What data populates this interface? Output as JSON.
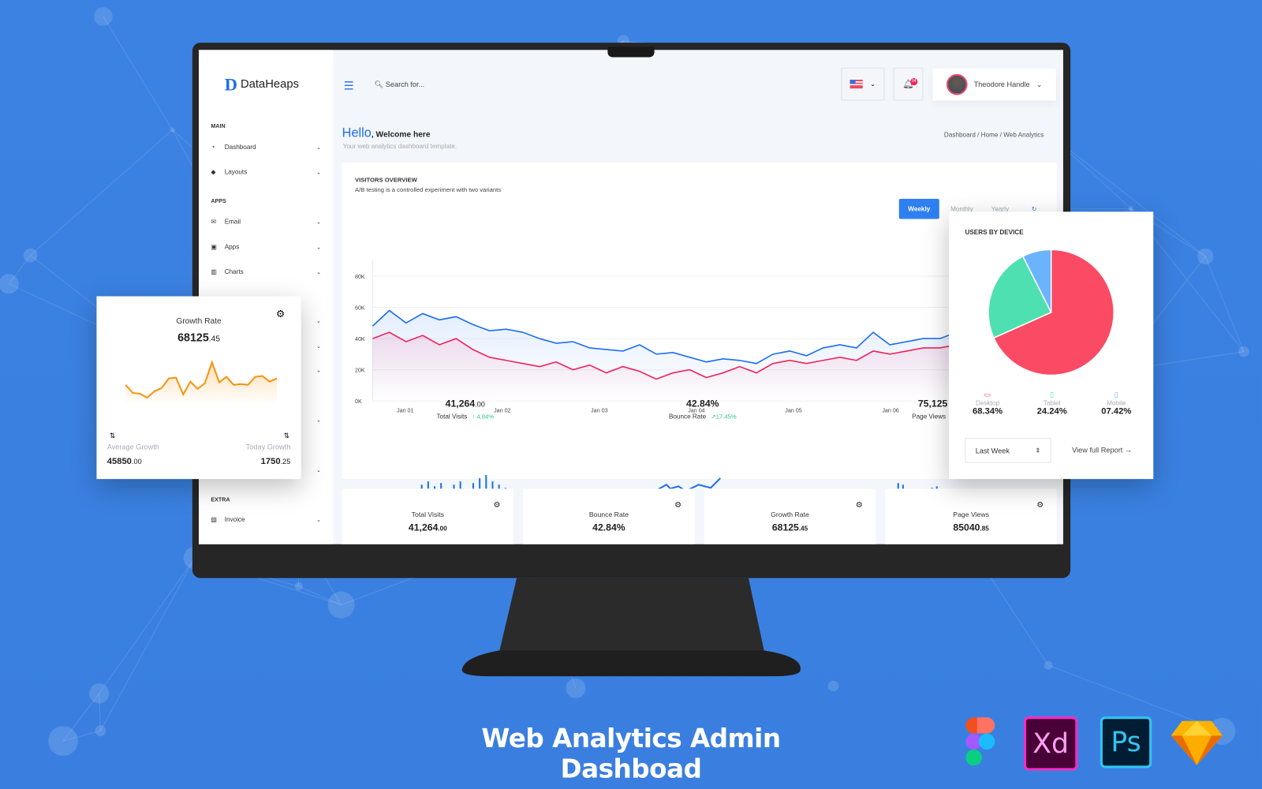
{
  "brand": {
    "name": "DataHeaps",
    "logo_letter": "D"
  },
  "search": {
    "placeholder": "Search for..."
  },
  "header": {
    "user_name": "Theodore Handle",
    "notifications": "04",
    "language": "us-flag-icon"
  },
  "sidebar": {
    "sections": [
      {
        "label": "MAIN",
        "items": [
          {
            "label": "Dashboard",
            "icon": "gauge-icon"
          },
          {
            "label": "Layouts",
            "icon": "layers-icon"
          }
        ]
      },
      {
        "label": "APPS",
        "items": [
          {
            "label": "Email",
            "icon": "envelope-icon"
          },
          {
            "label": "Apps",
            "icon": "tablet-icon"
          },
          {
            "label": "Charts",
            "icon": "bar-chart-icon"
          }
        ]
      },
      {
        "label": "EXTRA",
        "items": [
          {
            "label": "Invoice",
            "icon": "invoice-icon"
          }
        ]
      }
    ]
  },
  "page": {
    "hello": "Hello",
    "welcome": ", Welcome here",
    "subtitle": "Your web analytics dashboard template.",
    "breadcrumb": "Dashboard / Home / Web Analytics"
  },
  "visitors": {
    "title": "VISITORS OVERVIEW",
    "subtitle": "A/B testing is a controlled experiment with two variants",
    "tabs": [
      "Weekly",
      "Monthly",
      "Yearly"
    ],
    "active_tab": "Weekly",
    "stats": [
      {
        "value": "41,264",
        "decimals": ".00",
        "label": "Total Visits",
        "change": "↑ 4.84%"
      },
      {
        "value": "42.84%",
        "decimals": "",
        "label": "Bounce Rate",
        "change": "↗17.45%"
      },
      {
        "value": "75,125",
        "decimals": "",
        "label": "Page Views",
        "change": "↑"
      }
    ]
  },
  "chart_data": {
    "type": "line",
    "x_labels": [
      "Jan 01",
      "Jan 02",
      "Jan 03",
      "Jan 04",
      "Jan 05",
      "Jan 06"
    ],
    "y_ticks": [
      "0K",
      "20K",
      "40K",
      "60K",
      "80K"
    ],
    "ylim": [
      0,
      80000
    ],
    "grid": true,
    "colors": [
      "#1e6ff0",
      "#f0245f"
    ],
    "series": [
      {
        "values": [
          48000,
          58000,
          50000,
          56000,
          52000,
          54000,
          49000,
          45000,
          46000,
          44000,
          40000,
          37000,
          38000,
          34000,
          33000,
          32000,
          36000,
          30000,
          31000,
          28000,
          25000,
          27000,
          26000,
          24000,
          30000,
          32000,
          29000,
          34000,
          36000,
          34000,
          44000,
          36000,
          38000,
          40000,
          40000,
          44000,
          46000,
          48000,
          50000,
          52000,
          55000,
          50000
        ]
      },
      {
        "values": [
          40000,
          44000,
          38000,
          42000,
          36000,
          40000,
          33000,
          28000,
          26000,
          24000,
          22000,
          25000,
          20000,
          23000,
          18000,
          22000,
          19000,
          14000,
          18000,
          20000,
          15000,
          18000,
          22000,
          18000,
          24000,
          26000,
          24000,
          26000,
          28000,
          26000,
          32000,
          30000,
          32000,
          34000,
          34000,
          36000,
          38000,
          40000,
          38000,
          42000,
          44000,
          40000
        ]
      }
    ]
  },
  "mini_cards": [
    {
      "label": "Total Visits",
      "value": "41,264",
      "decimals": ".00"
    },
    {
      "label": "Bounce Rate",
      "value": "42.84%",
      "decimals": ""
    },
    {
      "label": "Growth Rate",
      "value": "68125",
      "decimals": ".45"
    },
    {
      "label": "Page Views",
      "value": "85040",
      "decimals": ".85"
    }
  ],
  "growth": {
    "title": "Growth Rate",
    "value": "68125",
    "decimals": ".45",
    "avg_label": "Average Growth",
    "avg_value": "45850",
    "avg_dec": ".00",
    "today_label": "Today Growth",
    "today_value": "1750",
    "today_dec": ".25",
    "color": "#f7940f",
    "values": [
      30,
      20,
      19,
      14,
      22,
      26,
      38,
      39,
      18,
      34,
      25,
      32,
      58,
      33,
      40,
      30,
      31,
      30,
      40,
      41,
      34,
      38
    ]
  },
  "device": {
    "title": "USERS BY DEVICE",
    "items": [
      {
        "label": "Desktop",
        "value": "68.34%",
        "pct": 68.34,
        "color": "#fb4a64"
      },
      {
        "label": "Tablet",
        "value": "24.24%",
        "pct": 24.24,
        "color": "#4ee0b0"
      },
      {
        "label": "Mobile",
        "value": "07.42%",
        "pct": 7.42,
        "color": "#69b4fc"
      }
    ],
    "range": "Last Week",
    "report_link": "View full Report →"
  },
  "banner": {
    "title": "Web Analytics Admin Dashboad",
    "tools": [
      "Figma",
      "Xd",
      "Ps",
      "Sketch"
    ]
  }
}
